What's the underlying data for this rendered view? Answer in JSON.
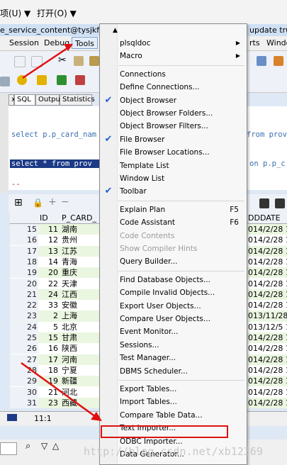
{
  "top_menu": [
    "项(U) ▼",
    "打开(O) ▼"
  ],
  "window_title": "e_service_content@tysjkf_vm",
  "window_title_right": "update trun",
  "app_menu": [
    "Session",
    "Debug",
    "Tools",
    "rts",
    "Windo"
  ],
  "tabs": [
    "SQL",
    "Output",
    "Statistics"
  ],
  "code": {
    "line1": "select p.p_card_nam",
    "line1_right": "from prov",
    "line2": "select * from prov",
    "line2_right": "on p.p_c",
    "line3": "--"
  },
  "grid": {
    "headers": [
      "ID",
      "P_CARD_",
      "DDDATE"
    ],
    "rows": [
      {
        "n": "15",
        "id": "11",
        "name": "湖南",
        "date": "014/2/28 18"
      },
      {
        "n": "16",
        "id": "12",
        "name": "贵州",
        "date": "014/2/28 18"
      },
      {
        "n": "17",
        "id": "13",
        "name": "江苏",
        "date": "014/2/28 18"
      },
      {
        "n": "18",
        "id": "14",
        "name": "青海",
        "date": "014/2/28 18"
      },
      {
        "n": "19",
        "id": "20",
        "name": "重庆",
        "date": "014/2/28 18"
      },
      {
        "n": "20",
        "id": "22",
        "name": "天津",
        "date": "014/2/28 18"
      },
      {
        "n": "21",
        "id": "24",
        "name": "江西",
        "date": "014/2/28 18"
      },
      {
        "n": "22",
        "id": "33",
        "name": "安徽",
        "date": "014/2/28 18"
      },
      {
        "n": "23",
        "id": "2",
        "name": "上海",
        "date": "013/11/28 1"
      },
      {
        "n": "24",
        "id": "5",
        "name": "北京",
        "date": "013/12/5 13"
      },
      {
        "n": "25",
        "id": "15",
        "name": "甘肃",
        "date": "014/2/28 18"
      },
      {
        "n": "26",
        "id": "16",
        "name": "陕西",
        "date": "014/2/28 18"
      },
      {
        "n": "27",
        "id": "17",
        "name": "河南",
        "date": "014/2/28 18"
      },
      {
        "n": "28",
        "id": "18",
        "name": "宁夏",
        "date": "014/2/28 18"
      },
      {
        "n": "29",
        "id": "19",
        "name": "新疆",
        "date": "014/2/28 18"
      },
      {
        "n": "30",
        "id": "21",
        "name": "河北",
        "date": "014/2/28 18"
      },
      {
        "n": "31",
        "id": "23",
        "name": "西藏",
        "date": "014/2/28 18"
      }
    ]
  },
  "status_position": "11:1",
  "tools_menu": [
    {
      "label": "plsqldoc",
      "submenu": true
    },
    {
      "label": "Macro",
      "submenu": true
    },
    {
      "sep": true
    },
    {
      "label": "Connections"
    },
    {
      "label": "Define Connections..."
    },
    {
      "label": "Object Browser",
      "checked": true
    },
    {
      "label": "Object Browser Folders..."
    },
    {
      "label": "Object Browser Filters..."
    },
    {
      "label": "File Browser",
      "checked": true
    },
    {
      "label": "File Browser Locations..."
    },
    {
      "label": "Template List"
    },
    {
      "label": "Window List"
    },
    {
      "label": "Toolbar",
      "checked": true
    },
    {
      "sep": true
    },
    {
      "label": "Explain Plan",
      "shortcut": "F5"
    },
    {
      "label": "Code Assistant",
      "shortcut": "F6"
    },
    {
      "label": "Code Contents",
      "disabled": true
    },
    {
      "label": "Show Compiler Hints",
      "disabled": true
    },
    {
      "label": "Query Builder..."
    },
    {
      "sep": true
    },
    {
      "label": "Find Database Objects..."
    },
    {
      "label": "Compile Invalid Objects..."
    },
    {
      "label": "Export User Objects..."
    },
    {
      "label": "Compare User Objects..."
    },
    {
      "label": "Event Monitor..."
    },
    {
      "label": "Sessions..."
    },
    {
      "label": "Test Manager..."
    },
    {
      "label": "DBMS Scheduler..."
    },
    {
      "sep": true
    },
    {
      "label": "Export Tables..."
    },
    {
      "label": "Import Tables..."
    },
    {
      "label": "Compare Table Data..."
    },
    {
      "label": "Text Importer...",
      "highlighted": true
    },
    {
      "label": "ODBC Importer..."
    },
    {
      "label": "Data Generator..."
    }
  ],
  "watermark": "http://blog.csdn.net/xb12369",
  "colors": {
    "highlight_box": "#e01010",
    "annotation_arrow": "#e01010",
    "check": "#2060d0"
  }
}
